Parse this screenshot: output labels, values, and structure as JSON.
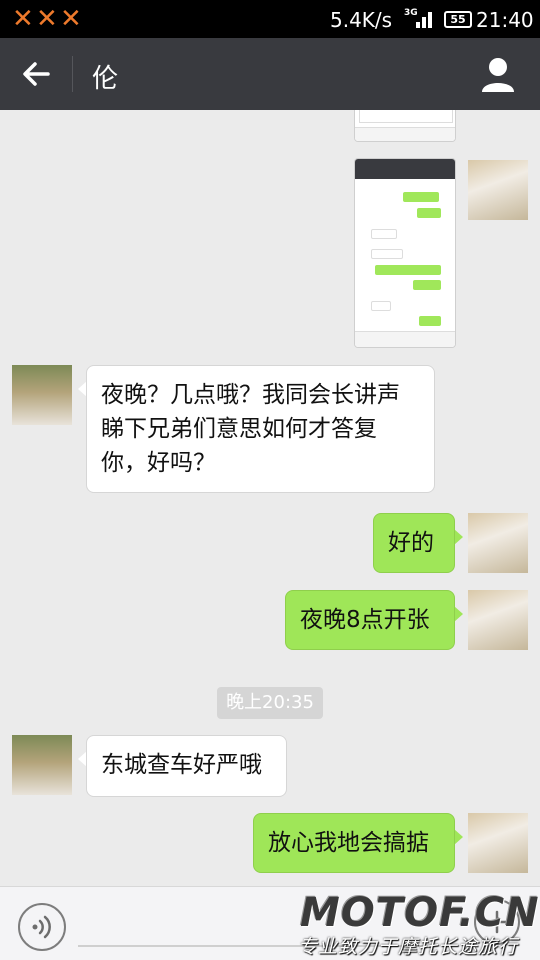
{
  "status_bar": {
    "net_speed": "5.4K/s",
    "battery": "55",
    "time": "21:40",
    "network_type": "3G"
  },
  "header": {
    "title": "伦"
  },
  "messages": [
    {
      "side": "left",
      "text": "夜晚？几点哦？我同会长讲声睇下兄弟们意思如何才答复你，好吗？"
    },
    {
      "side": "right",
      "text": "好的"
    },
    {
      "side": "right",
      "text": "夜晚8点开张"
    },
    {
      "side": "left",
      "text": "东城查车好严哦"
    },
    {
      "side": "right",
      "text": "放心我地会搞掂"
    }
  ],
  "timestamp": "晚上20:35",
  "watermark": {
    "logo": "MOTOF.CN",
    "slogan": "专业致力于摩托长途旅行"
  },
  "colors": {
    "title_bar": "#393a3f",
    "bubble_me": "#9fe658",
    "bubble_other": "#ffffff",
    "chat_bg": "#ebebeb",
    "status_x": "#ee7a2c"
  }
}
